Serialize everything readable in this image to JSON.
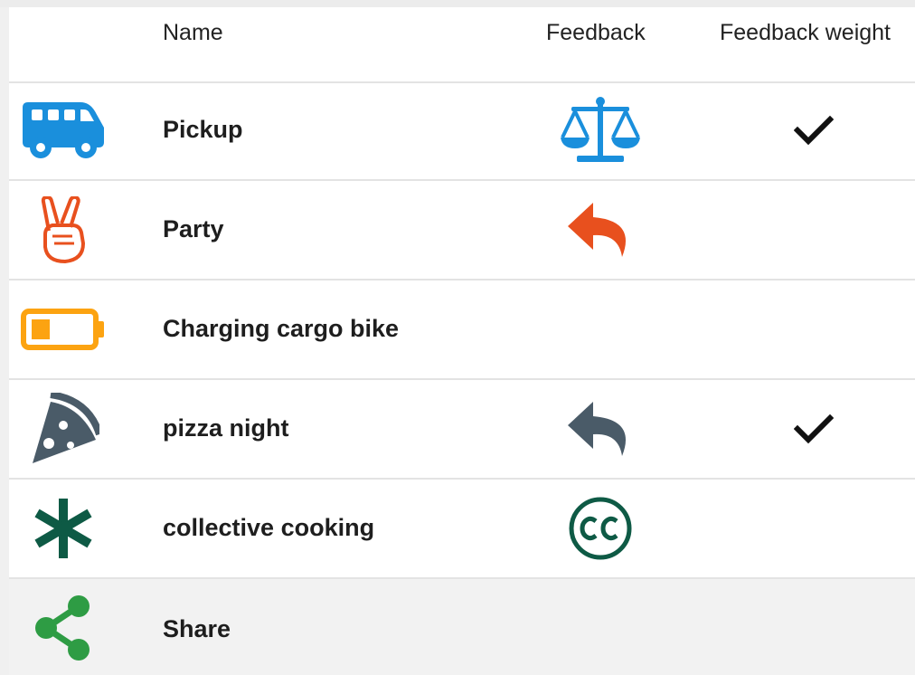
{
  "header": {
    "name": "Name",
    "feedback": "Feedback",
    "feedback_weight": "Feedback weight"
  },
  "colors": {
    "pickup": "#1a8fdc",
    "party": "#e8501e",
    "charging": "#fca311",
    "pizza": "#4a5b68",
    "cooking": "#0e5a45",
    "share": "#2e9c44"
  },
  "rows": [
    {
      "label": "Pickup",
      "icon": "bus-icon",
      "feedback_icon": "scale-balance-icon",
      "weighted": true
    },
    {
      "label": "Party",
      "icon": "victory-hand-icon",
      "feedback_icon": "reply-arrow-icon",
      "weighted": false
    },
    {
      "label": "Charging cargo bike",
      "icon": "battery-low-icon",
      "feedback_icon": "",
      "weighted": false
    },
    {
      "label": "pizza night",
      "icon": "pizza-slice-icon",
      "feedback_icon": "reply-arrow-icon",
      "weighted": true
    },
    {
      "label": "collective cooking",
      "icon": "asterisk-icon",
      "feedback_icon": "creative-commons-icon",
      "weighted": false
    }
  ],
  "share": {
    "label": "Share",
    "icon": "share-icon"
  }
}
